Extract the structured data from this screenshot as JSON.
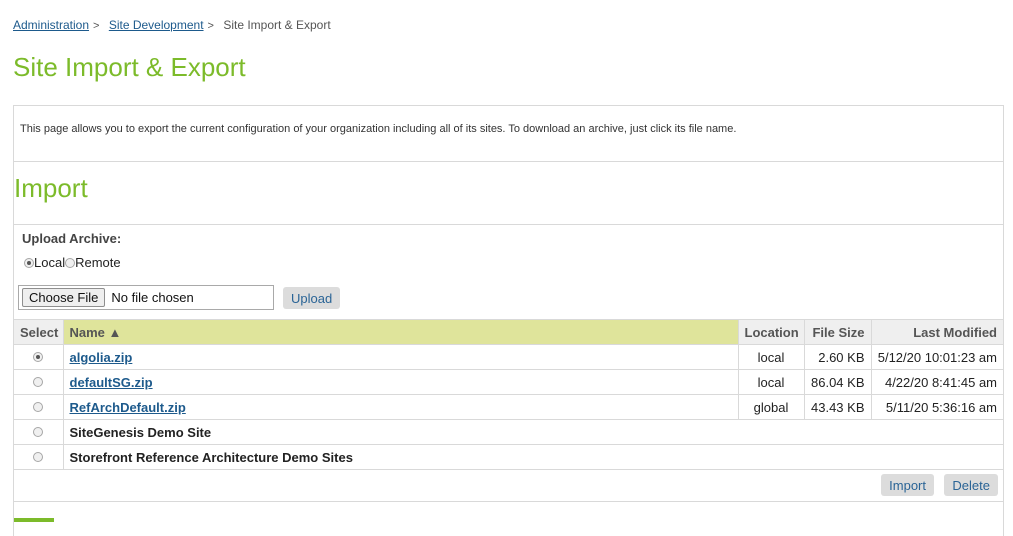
{
  "breadcrumb": {
    "items": [
      {
        "label": "Administration",
        "link": true
      },
      {
        "label": "Site Development",
        "link": true
      },
      {
        "label": "Site Import & Export",
        "link": false
      }
    ],
    "separator": ">"
  },
  "page": {
    "title": "Site Import & Export",
    "intro": "This page allows you to export the current configuration of your organization including all of its sites. To download an archive, just click its file name."
  },
  "import": {
    "heading": "Import",
    "upload_label": "Upload Archive:",
    "radios": [
      {
        "label": "Local",
        "checked": true
      },
      {
        "label": "Remote",
        "checked": false
      }
    ],
    "file_input": {
      "button": "Choose File",
      "status": "No file chosen"
    },
    "upload_button": "Upload"
  },
  "table": {
    "headers": {
      "select": "Select",
      "name": "Name ▲",
      "location": "Location",
      "size": "File Size",
      "modified": "Last Modified"
    },
    "rows": [
      {
        "name": "algolia.zip",
        "location": "local",
        "size": "2.60 KB",
        "modified": "5/12/20 10:01:23 am",
        "selected": true
      },
      {
        "name": "defaultSG.zip",
        "location": "local",
        "size": "86.04 KB",
        "modified": "4/22/20 8:41:45 am",
        "selected": false
      },
      {
        "name": "RefArchDefault.zip",
        "location": "global",
        "size": "43.43 KB",
        "modified": "5/11/20 5:36:16 am",
        "selected": false
      }
    ],
    "sites": [
      {
        "name": "SiteGenesis Demo Site",
        "selected": false
      },
      {
        "name": "Storefront Reference Architecture Demo Sites",
        "selected": false
      }
    ]
  },
  "actions": {
    "import": "Import",
    "delete": "Delete"
  }
}
